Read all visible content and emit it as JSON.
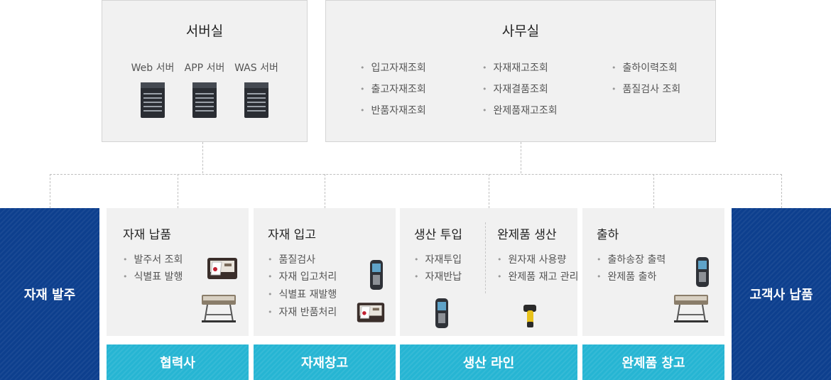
{
  "server_room": {
    "title": "서버실",
    "servers": [
      {
        "label": "Web 서버",
        "icon": "server-icon"
      },
      {
        "label": "APP 서버",
        "icon": "server-icon"
      },
      {
        "label": "WAS 서버",
        "icon": "server-icon"
      }
    ]
  },
  "office": {
    "title": "사무실",
    "items": [
      "입고자재조회",
      "출고자재조회",
      "반품자재조회",
      "자재재고조회",
      "자재결품조회",
      "완제품재고조회",
      "출하이력조회",
      "품질검사 조회"
    ]
  },
  "left_block": {
    "label": "자재 발주"
  },
  "right_block": {
    "label": "고객사 납품"
  },
  "stages": [
    {
      "title": "자재 납품",
      "items": [
        "발주서 조회",
        "식별표 발행"
      ],
      "footer": "협력사"
    },
    {
      "title": "자재 입고",
      "items": [
        "품질검사",
        "자재 입고처리",
        "식별표 재발행",
        "자재 반품처리"
      ],
      "footer": "자재창고"
    },
    {
      "title": "생산 투입",
      "items": [
        "자재투입",
        "자재반납"
      ],
      "title2": "완제품 생산",
      "items2": [
        "원자재 사용량",
        "완제품 재고 관리"
      ],
      "footer": "생산 라인"
    },
    {
      "title": "출하",
      "items": [
        "출하송장 출력",
        "완제품 출하"
      ],
      "footer": "완제품 창고"
    }
  ],
  "colors": {
    "dark_blue": "#0d3f8e",
    "cyan": "#26b5d3",
    "panel_bg": "#f1f1f1"
  }
}
